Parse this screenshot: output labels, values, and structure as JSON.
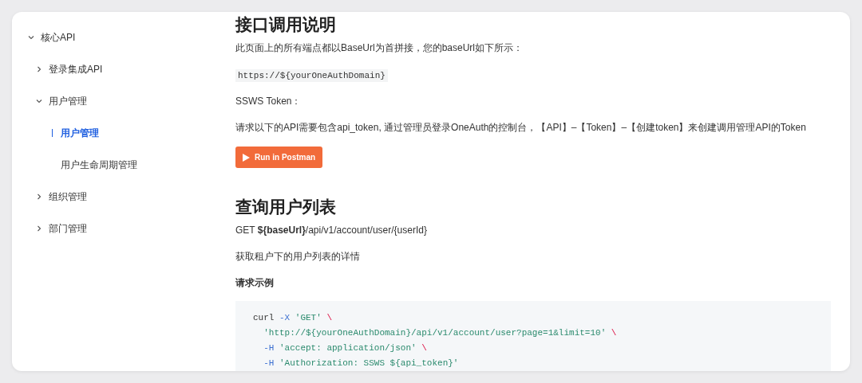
{
  "sidebar": {
    "items": [
      {
        "label": "核心API",
        "expanded": true,
        "selected": false,
        "children": [
          {
            "label": "登录集成API",
            "expanded": false,
            "selected": false
          },
          {
            "label": "用户管理",
            "expanded": true,
            "selected": false,
            "children": [
              {
                "label": "用户管理",
                "selected": true
              },
              {
                "label": "用户生命周期管理",
                "selected": false
              }
            ]
          },
          {
            "label": "组织管理",
            "expanded": false,
            "selected": false
          },
          {
            "label": "部门管理",
            "expanded": false,
            "selected": false
          }
        ]
      }
    ]
  },
  "content": {
    "blocks": [
      {
        "kind": "heading",
        "text": "接口调用说明"
      },
      {
        "kind": "paragraph",
        "text": "此页面上的所有端点都以BaseUrl为首拼接，您的baseUrl如下所示："
      },
      {
        "kind": "inline_code",
        "text": "https://${yourOneAuthDomain}"
      },
      {
        "kind": "paragraph",
        "text": "SSWS Token："
      },
      {
        "kind": "paragraph",
        "text": "请求以下的API需要包含api_token, 通过管理员登录OneAuth的控制台，【API】–【Token】–【创建token】来创建调用管理API的Token"
      },
      {
        "kind": "button",
        "text": "Run in Postman"
      },
      {
        "kind": "heading",
        "text": "查询用户列表"
      },
      {
        "kind": "paragraph",
        "text": "GET **${baseUrl}**/api/v1/account/user/{userId}"
      },
      {
        "kind": "paragraph",
        "text": "获取租户下的用户列表的详情"
      },
      {
        "kind": "label",
        "text": "请求示例"
      },
      {
        "kind": "code",
        "lines": [
          {
            "indented": false,
            "tokens": [
              {
                "kind": "plain",
                "text": "curl "
              },
              {
                "kind": "flag",
                "text": "-X"
              },
              {
                "kind": "string",
                "text": " 'GET' "
              },
              {
                "kind": "escape",
                "text": "\\"
              }
            ]
          },
          {
            "indented": true,
            "tokens": [
              {
                "kind": "string",
                "text": "'http://${yourOneAuthDomain}/api/v1/account/user?page=1&limit=10' "
              },
              {
                "kind": "escape",
                "text": "\\"
              }
            ]
          },
          {
            "indented": true,
            "tokens": [
              {
                "kind": "flag",
                "text": "-H"
              },
              {
                "kind": "string",
                "text": " 'accept: application/json' "
              },
              {
                "kind": "escape",
                "text": "\\"
              }
            ]
          },
          {
            "indented": true,
            "tokens": [
              {
                "kind": "flag",
                "text": "-H"
              },
              {
                "kind": "string",
                "text": " 'Authorization: SSWS ${api_token}'"
              }
            ]
          }
        ]
      }
    ]
  }
}
